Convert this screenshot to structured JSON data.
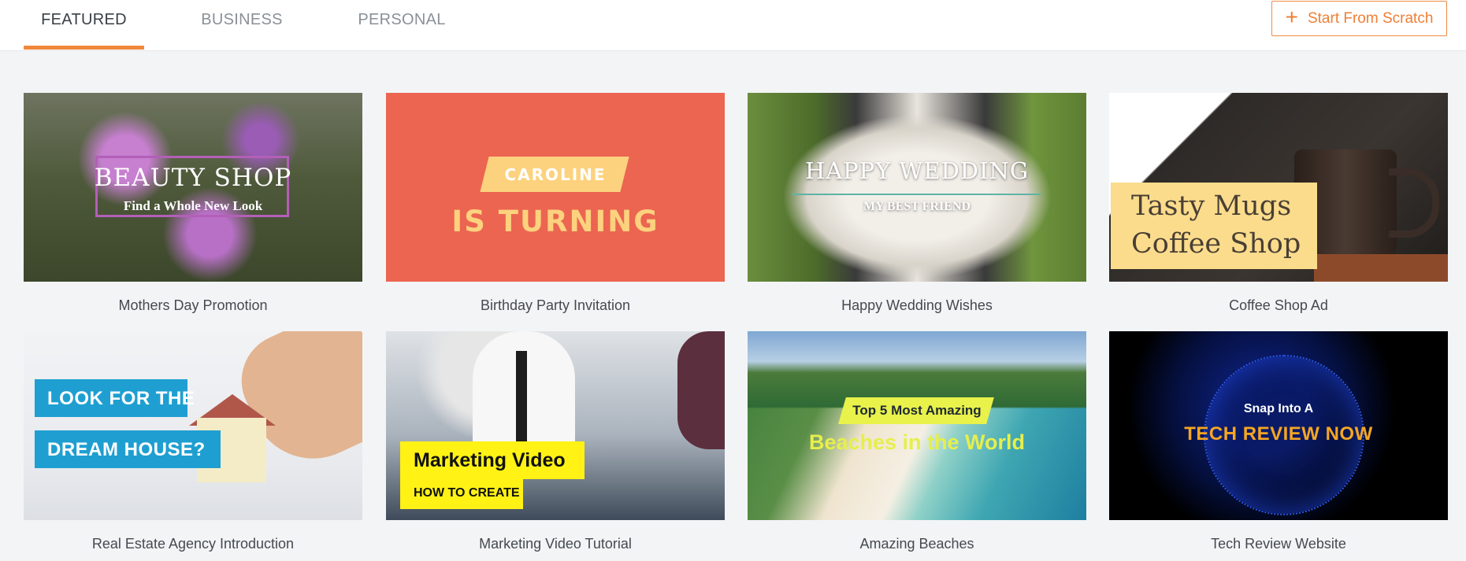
{
  "tabs": [
    {
      "label": "FEATURED",
      "active": true
    },
    {
      "label": "BUSINESS",
      "active": false
    },
    {
      "label": "PERSONAL",
      "active": false
    }
  ],
  "start_button": {
    "label": "Start From Scratch",
    "icon": "plus-icon"
  },
  "accent_color": "#f0883c",
  "templates": [
    {
      "caption": "Mothers Day Promotion",
      "lines": [
        "BEAUTY SHOP",
        "Find a Whole New Look"
      ]
    },
    {
      "caption": "Birthday Party Invitation",
      "lines": [
        "CAROLINE",
        "IS TURNING"
      ]
    },
    {
      "caption": "Happy Wedding Wishes",
      "lines": [
        "HAPPY WEDDING",
        "MY BEST FRIEND"
      ]
    },
    {
      "caption": "Coffee Shop Ad",
      "lines": [
        "Tasty Mugs",
        "Coffee Shop"
      ]
    },
    {
      "caption": "Real Estate Agency Introduction",
      "lines": [
        "LOOK FOR THE",
        "DREAM HOUSE?"
      ]
    },
    {
      "caption": "Marketing Video Tutorial",
      "lines": [
        "Marketing Video",
        "HOW TO CREATE"
      ]
    },
    {
      "caption": "Amazing Beaches",
      "lines": [
        "Top 5 Most Amazing",
        "Beaches in the World"
      ]
    },
    {
      "caption": "Tech Review Website",
      "lines": [
        "Snap Into A",
        "TECH REVIEW NOW"
      ]
    }
  ]
}
